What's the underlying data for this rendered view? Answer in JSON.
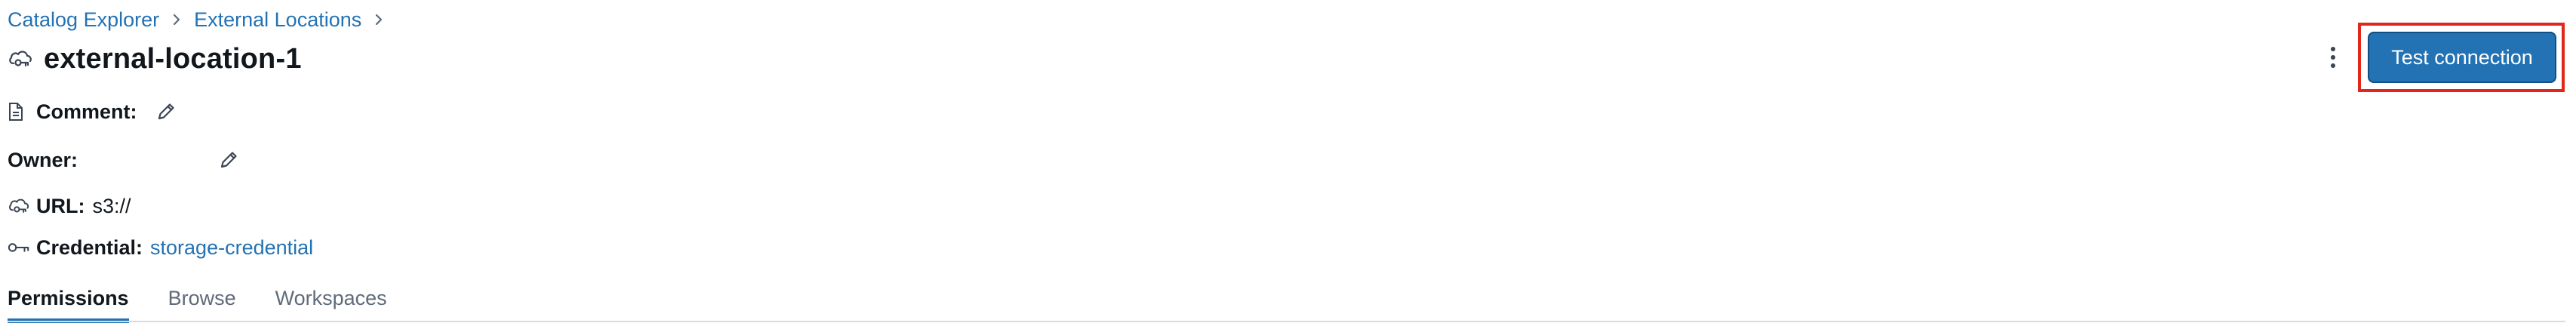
{
  "breadcrumb": {
    "items": [
      {
        "label": "Catalog Explorer"
      },
      {
        "label": "External Locations"
      }
    ],
    "separator": "›"
  },
  "header": {
    "title": "external-location-1",
    "icon": "cloud-key-icon",
    "primary_action_label": "Test connection",
    "more_menu_icon": "kebab-menu-icon"
  },
  "details": {
    "comment": {
      "label": "Comment:",
      "icon": "document-icon",
      "edit_icon": "pencil-icon"
    },
    "owner": {
      "label": "Owner:",
      "value": "",
      "edit_icon": "pencil-icon"
    },
    "url": {
      "label": "URL:",
      "value": "s3://",
      "icon": "cloud-key-icon"
    },
    "credential": {
      "label": "Credential:",
      "value": "storage-credential",
      "icon": "key-icon"
    }
  },
  "tabs": [
    {
      "label": "Permissions",
      "active": true
    },
    {
      "label": "Browse",
      "active": false
    },
    {
      "label": "Workspaces",
      "active": false
    }
  ],
  "colors": {
    "accent": "#2272b4",
    "highlight_border": "#e0271b",
    "text": "#11171c",
    "muted": "#5f6b7a"
  }
}
